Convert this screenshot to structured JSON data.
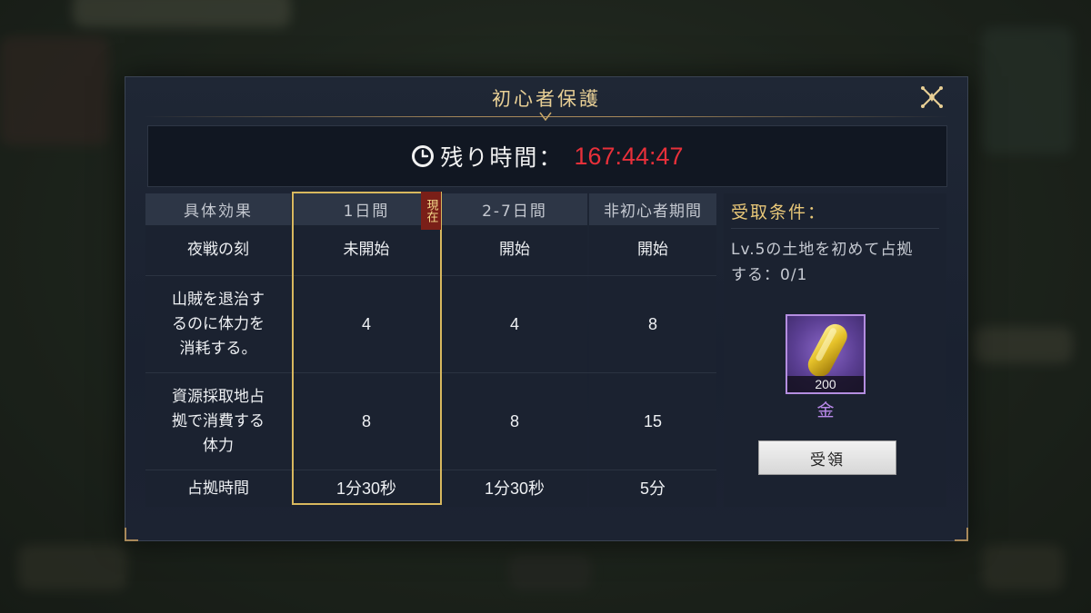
{
  "dialog": {
    "title": "初心者保護",
    "close_icon": "close-x-icon"
  },
  "timer": {
    "icon": "clock-icon",
    "label": "残り時間：",
    "value": "167:44:47",
    "value_color": "#e8303a"
  },
  "table": {
    "headers": [
      "具体効果",
      "1日間",
      "2-7日間",
      "非初心者期間"
    ],
    "current_badge": "現在",
    "rows": [
      {
        "effect": "夜戦の刻",
        "day1": "未開始",
        "day2_7": "開始",
        "non_beginner": "開始"
      },
      {
        "effect": "山賊を退治するのに体力を消耗する。",
        "effect_lines": [
          "山賊を退治す",
          "るのに体力を",
          "消耗する。"
        ],
        "day1": "4",
        "day2_7": "4",
        "non_beginner": "8"
      },
      {
        "effect": "資源採取地占拠で消費する体力",
        "effect_lines": [
          "資源採取地占",
          "拠で消費する",
          "体力"
        ],
        "day1": "8",
        "day2_7": "8",
        "non_beginner": "15"
      },
      {
        "effect": "占拠時間",
        "day1": "1分30秒",
        "day2_7": "1分30秒",
        "non_beginner": "5分"
      }
    ]
  },
  "conditions": {
    "title": "受取条件：",
    "text_lines": [
      "Lv.5の土地を初めて占拠",
      "する：0/1"
    ]
  },
  "reward": {
    "icon": "gold-ingot-icon",
    "count": "200",
    "name": "金",
    "frame_color": "#b48ee0"
  },
  "claim_button": {
    "label": "受領"
  },
  "colors": {
    "accent_gold": "#e8cf95",
    "current_border": "#d8b85e"
  }
}
